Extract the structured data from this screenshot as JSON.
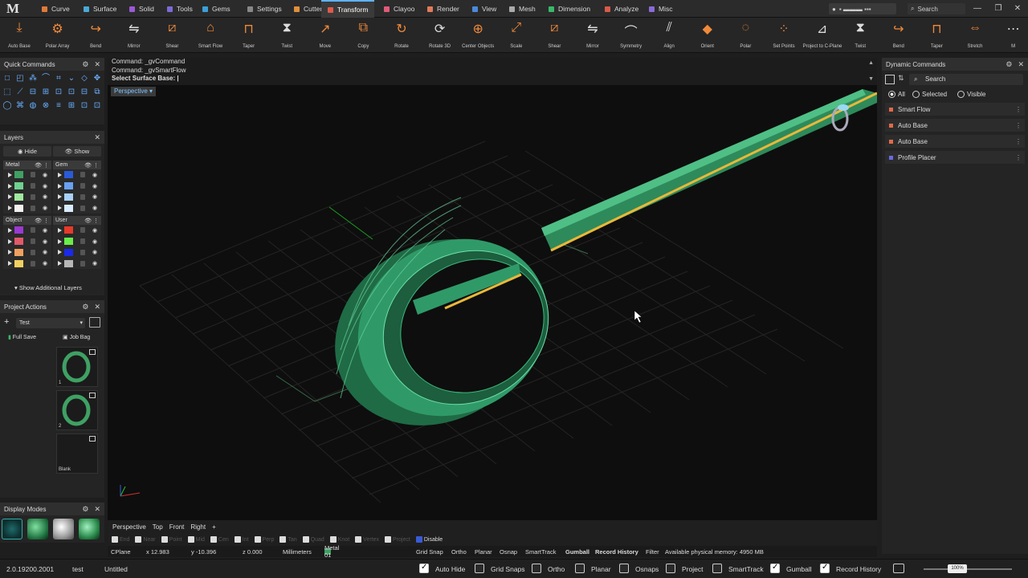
{
  "app": {
    "logo": "M"
  },
  "tabs": [
    {
      "label": "Curve",
      "color": "#e07a3a"
    },
    {
      "label": "Surface",
      "color": "#4aa8d8"
    },
    {
      "label": "Solid",
      "color": "#9b59d6"
    },
    {
      "label": "Tools",
      "color": "#7b6bd6"
    },
    {
      "label": "Gems",
      "color": "#3aa0d8"
    },
    {
      "label": "Settings",
      "color": "#888888"
    },
    {
      "label": "Cutters",
      "color": "#e0903a"
    },
    {
      "label": "Transform",
      "color": "#e05a4a",
      "active": true
    },
    {
      "label": "Clayoo",
      "color": "#e05a7a"
    },
    {
      "label": "Render",
      "color": "#e07a5a"
    },
    {
      "label": "View",
      "color": "#4a8ad8"
    },
    {
      "label": "Mesh",
      "color": "#aaaaaa"
    },
    {
      "label": "Dimension",
      "color": "#3ab86a"
    },
    {
      "label": "Analyze",
      "color": "#d85a4a"
    },
    {
      "label": "Misc",
      "color": "#8a6ad8"
    }
  ],
  "titlebar": {
    "user": "▪ ▬▬▬ ▪▪▪",
    "search": "Search"
  },
  "toolbar": [
    "Auto Base",
    "Polar Array",
    "Bend",
    "Mirror",
    "Shear",
    "Smart Flow",
    "Taper",
    "Twist",
    "Move",
    "Copy",
    "Rotate",
    "Rotate 3D",
    "Center Objects",
    "Scale",
    "Shear",
    "Mirror",
    "Symmetry",
    "Align",
    "Orient",
    "Polar",
    "Set Points",
    "Project to C-Plane",
    "Twist",
    "Bend",
    "Taper",
    "Stretch",
    "M"
  ],
  "quick_commands": {
    "title": "Quick Commands"
  },
  "layers": {
    "title": "Layers",
    "hide": "Hide",
    "show": "Show",
    "groups": [
      {
        "name": "Metal",
        "colors": [
          "#3fa063",
          "#6fd08f",
          "#a0e8a0",
          "#f2f2f2"
        ]
      },
      {
        "name": "Gem",
        "colors": [
          "#2a5ad8",
          "#6aa0f0",
          "#a8d0f8",
          "#d8ecff"
        ]
      },
      {
        "name": "Object",
        "colors": [
          "#9a3ad0",
          "#e05a6a",
          "#f0a060",
          "#f0d060"
        ]
      },
      {
        "name": "User",
        "colors": [
          "#e83a2a",
          "#6aee4a",
          "#1a2ae8",
          "#b8b8b8"
        ]
      }
    ],
    "show_additional": "Show Additional Layers"
  },
  "project_actions": {
    "title": "Project Actions",
    "project": "Test",
    "full_save": "Full Save",
    "job_bag": "Job Bag",
    "thumbs": [
      "1",
      "2",
      "Blank"
    ]
  },
  "display_modes": {
    "title": "Display Modes"
  },
  "command_history": [
    "Command: _gvCommand",
    "Command: _gvSmartFlow",
    "Select Surface Base: |"
  ],
  "viewport": {
    "label": "Perspective"
  },
  "view_tabs": [
    "Perspective",
    "Top",
    "Front",
    "Right",
    "+"
  ],
  "osnaps": [
    {
      "label": "End",
      "on": false
    },
    {
      "label": "Near",
      "on": false
    },
    {
      "label": "Point",
      "on": false
    },
    {
      "label": "Mid",
      "on": false
    },
    {
      "label": "Cen",
      "on": false
    },
    {
      "label": "Int",
      "on": false
    },
    {
      "label": "Perp",
      "on": false
    },
    {
      "label": "Tan",
      "on": false
    },
    {
      "label": "Quad",
      "on": false
    },
    {
      "label": "Knot",
      "on": false
    },
    {
      "label": "Vertex",
      "on": false
    },
    {
      "label": "Project",
      "on": false
    },
    {
      "label": "Disable",
      "on": true
    }
  ],
  "coords": {
    "cplane": "CPlane",
    "x": "x 12.983",
    "y": "y -10.396",
    "z": "z 0.000",
    "units": "Millimeters",
    "layer": "Metal 01",
    "grid_snap": "Grid Snap",
    "ortho": "Ortho",
    "planar": "Planar",
    "osnap": "Osnap",
    "smarttrack": "SmartTrack",
    "gumball": "Gumball",
    "record_history": "Record History",
    "filter": "Filter",
    "memory": "Available physical memory: 4950 MB"
  },
  "status": {
    "version": "2.0.19200.2001",
    "project": "test",
    "file": "Untitled",
    "toggles": [
      {
        "label": "Auto Hide",
        "on": true
      },
      {
        "label": "Grid Snaps",
        "on": false
      },
      {
        "label": "Ortho",
        "on": false
      },
      {
        "label": "Planar",
        "on": false
      },
      {
        "label": "Osnaps",
        "on": false
      },
      {
        "label": "Project",
        "on": false
      },
      {
        "label": "SmartTrack",
        "on": false
      },
      {
        "label": "Gumball",
        "on": true
      },
      {
        "label": "Record History",
        "on": true
      }
    ],
    "zoom": "100%"
  },
  "dynamic_commands": {
    "title": "Dynamic Commands",
    "search": "Search",
    "filters": [
      "All",
      "Selected",
      "Visible"
    ],
    "items": [
      {
        "label": "Smart Flow",
        "color": "#e06a4a"
      },
      {
        "label": "Auto Base",
        "color": "#e06a4a"
      },
      {
        "label": "Auto Base",
        "color": "#e06a4a"
      },
      {
        "label": "Profile Placer",
        "color": "#6a6ae0"
      }
    ]
  }
}
